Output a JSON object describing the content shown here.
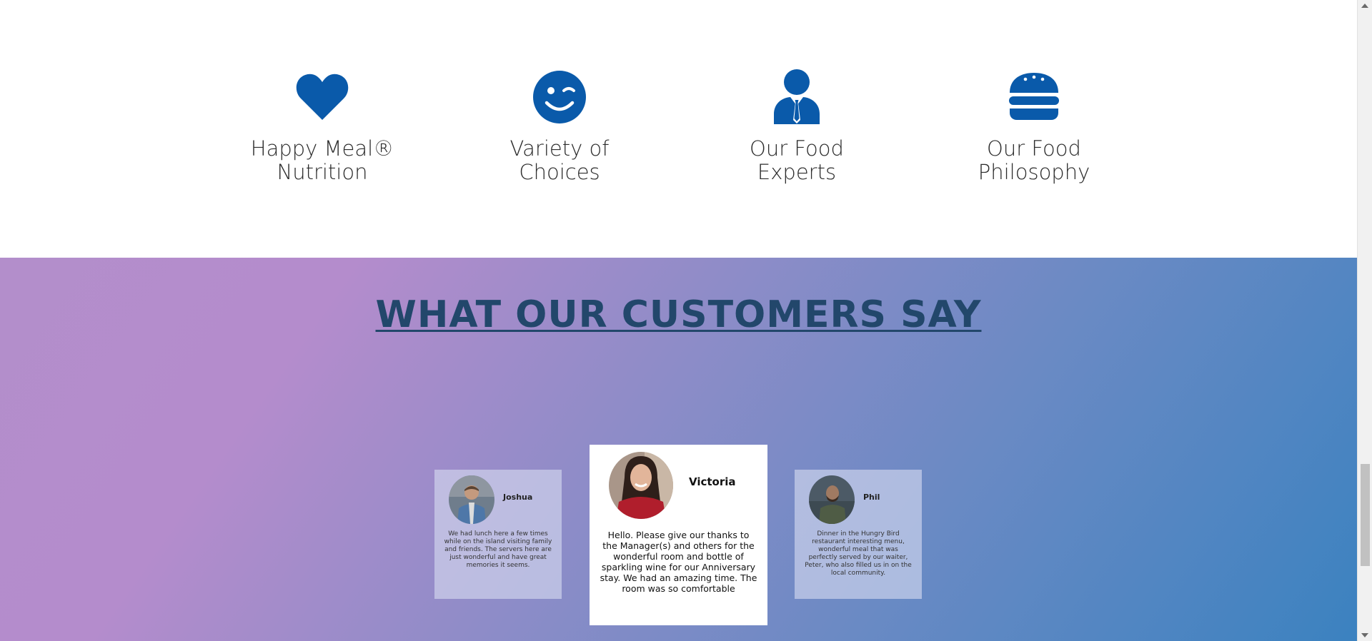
{
  "features": [
    {
      "icon": "heart-icon",
      "label": "Happy Meal® Nutrition"
    },
    {
      "icon": "wink-face-icon",
      "label": "Variety of Choices"
    },
    {
      "icon": "person-tie-icon",
      "label": "Our Food Experts"
    },
    {
      "icon": "burger-icon",
      "label": "Our Food Philosophy"
    }
  ],
  "labels": {
    "f1_line1": "Happy Meal®",
    "f1_line2": "Nutrition",
    "f2_line1": "Variety of",
    "f2_line2": "Choices",
    "f3_line1": "Our Food",
    "f3_line2": "Experts",
    "f4_line1": "Our Food",
    "f4_line2": "Philosophy"
  },
  "testimonials": {
    "title": "WHAT OUR CUSTOMERS SAY",
    "cards": [
      {
        "name": "Joshua",
        "quote": "We had lunch here a few times while on the island visiting family and friends. The servers here are just wonderful and have great memories it seems."
      },
      {
        "name": "Victoria",
        "quote": "Hello. Please give our thanks to the Manager(s) and others for the wonderful room and bottle of sparkling wine for our Anniversary stay. We had an amazing time. The room was so comfortable"
      },
      {
        "name": "Phil",
        "quote": "Dinner in the Hungry Bird restaurant interesting menu, wonderful meal that was perfectly served by our waiter, Peter, who also filled us in on the local community."
      }
    ]
  },
  "colors": {
    "icon_blue": "#0a5aaa",
    "title_color": "#22476b",
    "gradient_start": "#b48ccc",
    "gradient_end": "#3b82c0"
  }
}
